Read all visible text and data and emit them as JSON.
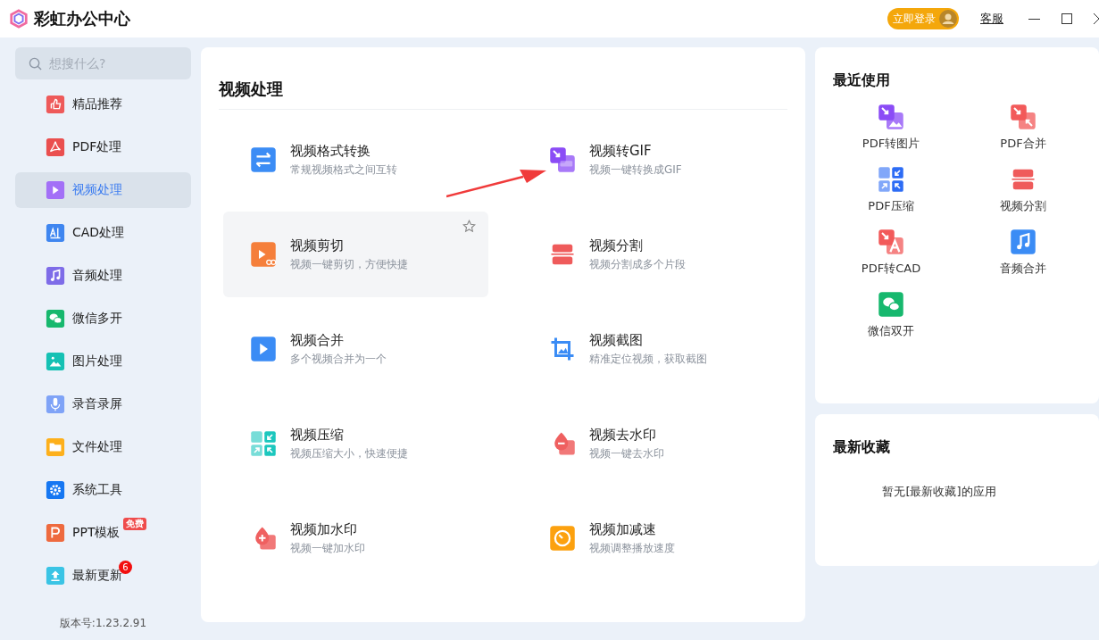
{
  "window": {
    "title": "彩虹办公中心",
    "login_button": "立即登录",
    "support_link": "客服"
  },
  "sidebar": {
    "search": {
      "placeholder": "想搜什么?"
    },
    "items": [
      {
        "label": "精品推荐",
        "kind": "thumbs",
        "color": "#ee5a5a",
        "selected": false
      },
      {
        "label": "PDF处理",
        "kind": "pdf",
        "color": "#ea4f4f",
        "selected": false
      },
      {
        "label": "视频处理",
        "kind": "play",
        "color": "#a370f7",
        "selected": true
      },
      {
        "label": "CAD处理",
        "kind": "cad",
        "color": "#3f86f0",
        "selected": false
      },
      {
        "label": "音频处理",
        "kind": "music",
        "color": "#7e6ce8",
        "selected": false
      },
      {
        "label": "微信多开",
        "kind": "chat",
        "color": "#17b86e",
        "selected": false
      },
      {
        "label": "图片处理",
        "kind": "image",
        "color": "#15c1b4",
        "selected": false
      },
      {
        "label": "录音录屏",
        "kind": "mic",
        "color": "#7fa3f7",
        "selected": false
      },
      {
        "label": "文件处理",
        "kind": "folder",
        "color": "#fdb01c",
        "selected": false
      },
      {
        "label": "系统工具",
        "kind": "gear",
        "color": "#1677f2",
        "selected": false
      },
      {
        "label": "PPT模板",
        "kind": "ppt",
        "color": "#ee6a3f",
        "selected": false,
        "badge": {
          "kind": "tag",
          "text": "免费"
        }
      },
      {
        "label": "最新更新",
        "kind": "upload",
        "color": "#3ac4e5",
        "selected": false,
        "badge": {
          "kind": "count",
          "text": "6"
        }
      }
    ],
    "version": "版本号:1.23.2.91"
  },
  "main": {
    "title": "视频处理",
    "tools": [
      {
        "name": "视频格式转换",
        "description": "常规视频格式之间互转",
        "kind": "swap",
        "color": "#3b8cf5",
        "highlighted": false
      },
      {
        "name": "视频转GIF",
        "description": "视频一键转换成GIF",
        "kind": "gif",
        "color": "#8b4cf6",
        "highlighted": false
      },
      {
        "name": "视频剪切",
        "description": "视频一键剪切，方便快捷",
        "kind": "cut",
        "color": "#f57f3b",
        "highlighted": true
      },
      {
        "name": "视频分割",
        "description": "视频分割成多个片段",
        "kind": "split",
        "color": "#ef5b5b",
        "highlighted": false
      },
      {
        "name": "视频合并",
        "description": "多个视频合并为一个",
        "kind": "merge",
        "color": "#3b8cf5",
        "highlighted": false
      },
      {
        "name": "视频截图",
        "description": "精准定位视频，获取截图",
        "kind": "crop",
        "color": "#3b8cf5",
        "highlighted": false
      },
      {
        "name": "视频压缩",
        "description": "视频压缩大小，快速便捷",
        "kind": "compress",
        "color": "#1cc7be",
        "highlighted": false
      },
      {
        "name": "视频去水印",
        "description": "视频一键去水印",
        "kind": "drop-minus",
        "color": "#ef6060",
        "highlighted": false
      },
      {
        "name": "视频加水印",
        "description": "视频一键加水印",
        "kind": "drop-plus",
        "color": "#ef6060",
        "highlighted": false
      },
      {
        "name": "视频加减速",
        "description": "视频调整播放速度",
        "kind": "speed",
        "color": "#fca10f",
        "highlighted": false
      }
    ]
  },
  "recent": {
    "title": "最近使用",
    "items": [
      {
        "label": "PDF转图片",
        "kind": "image",
        "color": "#8b4cf6"
      },
      {
        "label": "PDF合并",
        "kind": "merge-arrows",
        "color": "#f25a5a"
      },
      {
        "label": "PDF压缩",
        "kind": "compress",
        "color": "#2d6cf5"
      },
      {
        "label": "视频分割",
        "kind": "split",
        "color": "#ef5b5b"
      },
      {
        "label": "PDF转CAD",
        "kind": "letter-a",
        "color": "#f25a5a"
      },
      {
        "label": "音频合并",
        "kind": "music",
        "color": "#3b8cf5"
      },
      {
        "label": "微信双开",
        "kind": "chat",
        "color": "#17b86e"
      }
    ]
  },
  "favorites": {
    "title": "最新收藏",
    "empty_text": "暂无[最新收藏]的应用"
  }
}
